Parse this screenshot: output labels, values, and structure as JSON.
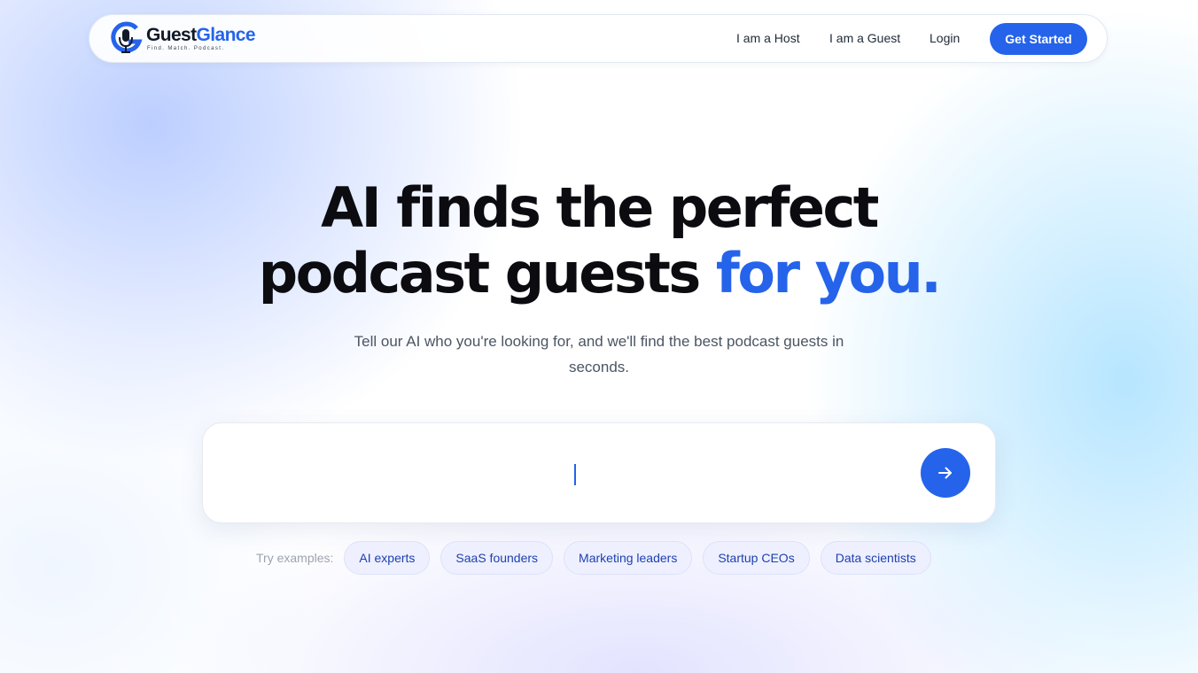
{
  "brand": {
    "name_main": "Guest",
    "name_accent": "Glance",
    "tagline": "Find. Match. Podcast.",
    "logo_icon": "microphone-g-icon"
  },
  "nav": {
    "links": [
      "I am a Host",
      "I am a Guest",
      "Login"
    ],
    "cta": "Get Started"
  },
  "hero": {
    "title_line1": "AI finds the perfect",
    "title_line2": "podcast guests",
    "title_highlight": "for you.",
    "subtitle": "Tell our AI who you're looking for, and we'll find the best podcast guests in seconds."
  },
  "search": {
    "value": "",
    "placeholder": "",
    "submit_icon": "arrow-right-icon"
  },
  "examples": {
    "label": "Try examples:",
    "chips": [
      "AI experts",
      "SaaS founders",
      "Marketing leaders",
      "Startup CEOs",
      "Data scientists"
    ]
  },
  "colors": {
    "accent": "#2563eb",
    "text": "#0b0b10",
    "chip_bg": "#eef0ff",
    "chip_text": "#1e40af"
  }
}
